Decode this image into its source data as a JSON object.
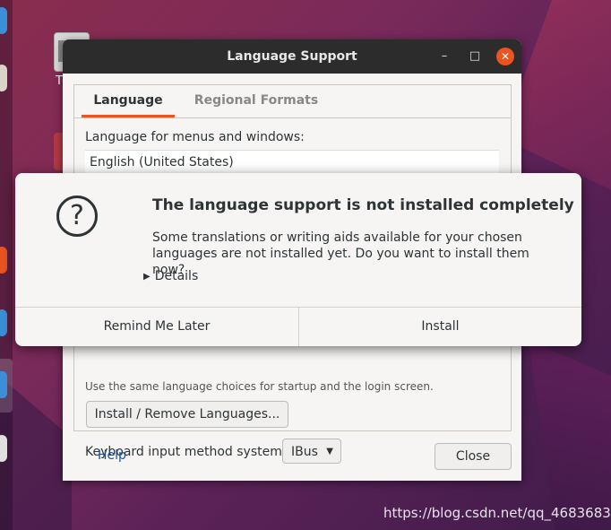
{
  "window": {
    "title": "Language Support",
    "controls": {
      "minimize": "–",
      "maximize": "□",
      "close": "✕"
    }
  },
  "tabs": [
    {
      "label": "Language",
      "active": true
    },
    {
      "label": "Regional Formats",
      "active": false
    }
  ],
  "language_tab": {
    "menus_label": "Language for menus and windows:",
    "languages": [
      "English (United States)"
    ],
    "apply_hint": "Use the same language choices for startup and the login screen.",
    "install_remove_label": "Install / Remove Languages...",
    "keyboard_label": "Keyboard input method system:",
    "keyboard_value": "IBus"
  },
  "footer": {
    "help_label": "Help",
    "close_label": "Close"
  },
  "dialog": {
    "icon": "question-icon",
    "title": "The language support is not installed completely",
    "message": "Some translations or writing aids available for your chosen languages are not installed yet. Do you want to install them now?",
    "details_label": "Details",
    "remind_label": "Remind Me Later",
    "install_label": "Install"
  },
  "desktop": {
    "icon_label": "T"
  },
  "watermark": "https://blog.csdn.net/qq_46836833",
  "colors": {
    "accent": "#e95420",
    "titlebar": "#2c2c2c",
    "link": "#15539e"
  }
}
